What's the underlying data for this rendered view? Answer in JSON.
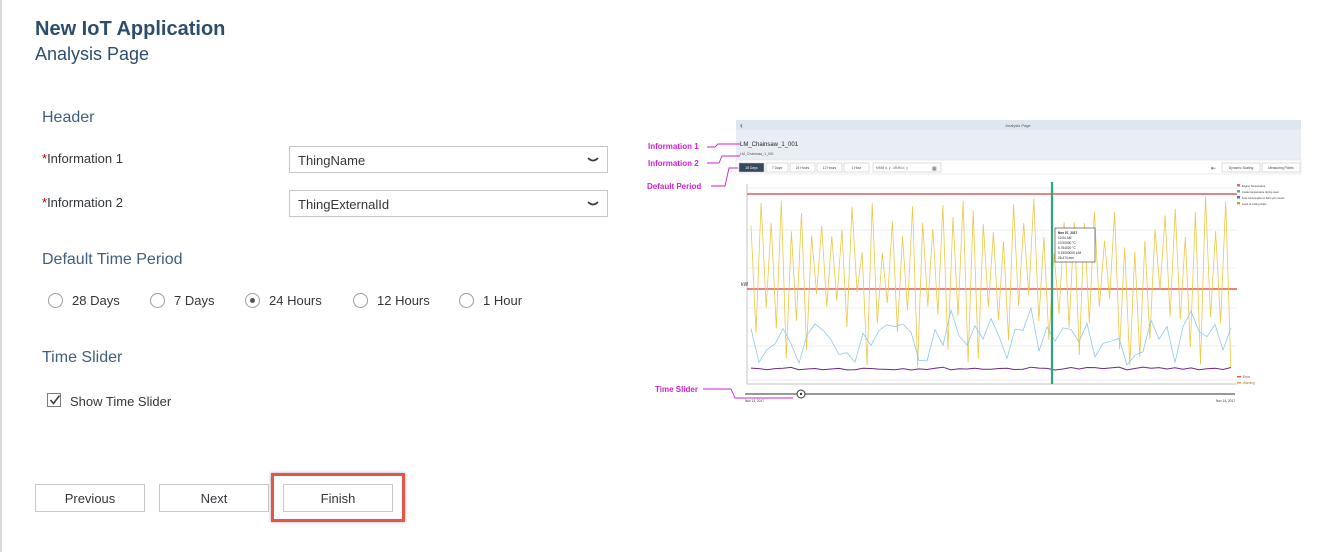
{
  "page": {
    "title": "New IoT Application",
    "subtitle": "Analysis Page"
  },
  "header_section": {
    "title": "Header",
    "required_marker": "*",
    "info1": {
      "label": "Information 1",
      "value": "ThingName"
    },
    "info2": {
      "label": "Information 2",
      "value": "ThingExternalId"
    }
  },
  "period_section": {
    "title": "Default Time Period",
    "options": [
      "28 Days",
      "7 Days",
      "24 Hours",
      "12 Hours",
      "1 Hour"
    ],
    "selected": "24 Hours"
  },
  "slider_section": {
    "title": "Time Slider",
    "checkbox_label": "Show Time Slider",
    "checked": true
  },
  "buttons": {
    "previous": "Previous",
    "next": "Next",
    "finish": "Finish"
  },
  "preview": {
    "header": "Analysis Page",
    "thing_name": "LM_Chainsaw_1_001",
    "thing_id": "LM_Chainsaw_1_001",
    "period_tabs": [
      "28 Days",
      "7 Days",
      "24 Hours",
      "12 Hours",
      "1 Hour"
    ],
    "date_placeholder": "MMM d, y - MMM d, y",
    "toolbar_buttons": [
      "Dynamic Scaling",
      "Measuring Points"
    ],
    "y_axis_label": "kW",
    "legend": [
      "Engine Temperature",
      "Cooler temperature during used",
      "Fuel consumption in liters per minute",
      "Level of cutting chain"
    ],
    "tooltip": [
      "Nov 07, 2017",
      "10:00 AM",
      "10.00000 °C",
      "6.764020 °C",
      "0.19000000 L/M",
      "26.474 mm"
    ],
    "bottom_legend": [
      "Error",
      "Warning"
    ],
    "slider_start": "Nov 13, 2017",
    "slider_end": "Nov 14, 2017",
    "annotations": {
      "info1": "Information 1",
      "info2": "Information 2",
      "default_period": "Default Period",
      "time_slider": "Time Slider"
    },
    "colors": {
      "annotation": "#d020d0",
      "series_yellow": "#ecc84a",
      "series_blue": "#8ec9ea",
      "series_purple": "#6a2a8c",
      "threshold_red": "#e05a5a",
      "cursor_green": "#2aa87a"
    }
  }
}
